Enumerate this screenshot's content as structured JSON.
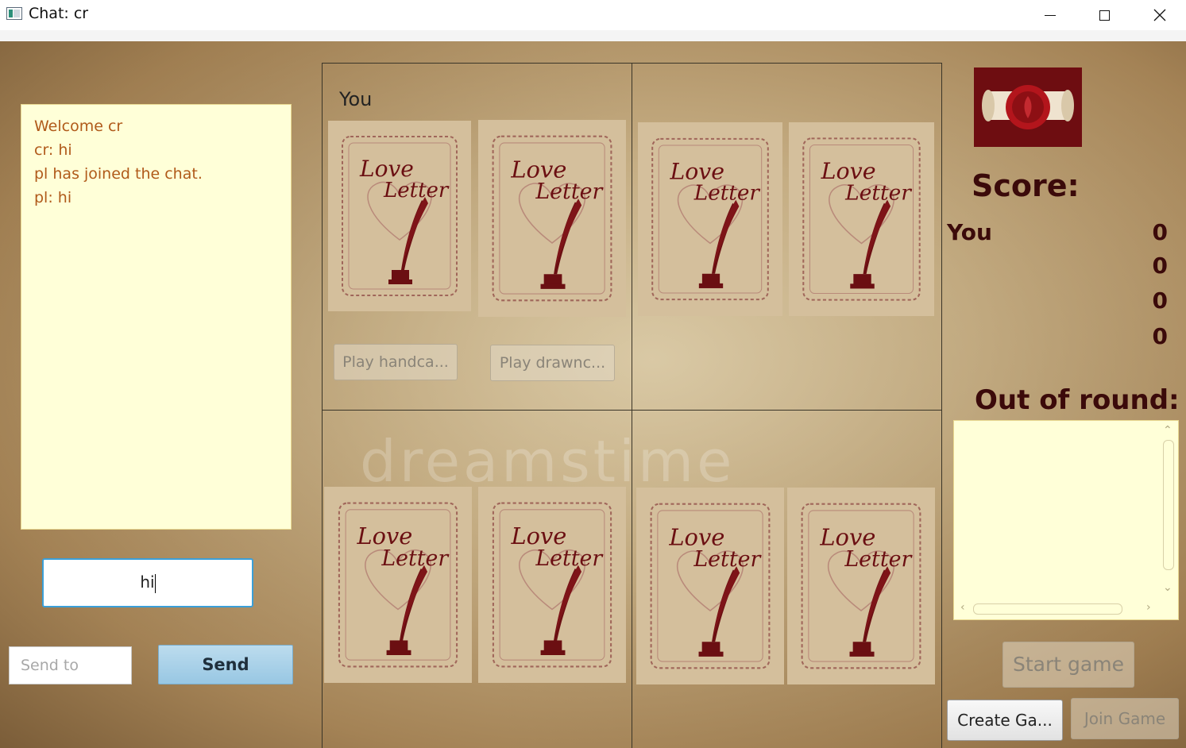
{
  "window": {
    "title": "Chat: cr"
  },
  "chat": {
    "messages": [
      "Welcome cr",
      "cr: hi",
      "pl has joined the chat.",
      "pl: hi"
    ],
    "input_value": "hi",
    "send_to_placeholder": "Send to",
    "send_label": "Send"
  },
  "board": {
    "player_label": "You",
    "play_handcard_label": "Play handca...",
    "play_drawncard_label": "Play drawnc...",
    "watermark": "dreamstime",
    "card_title": "Love Letter"
  },
  "score": {
    "title": "Score:",
    "rows": [
      {
        "name": "You",
        "value": "0"
      },
      {
        "name": "",
        "value": "0"
      },
      {
        "name": "",
        "value": "0"
      },
      {
        "name": "",
        "value": "0"
      }
    ]
  },
  "out_of_round": {
    "title": "Out of round:"
  },
  "buttons": {
    "start_game": "Start game",
    "create_game": "Create Ga...",
    "join_game": "Join Game"
  },
  "icons": {
    "app": "app-window-icon",
    "seal": "wax-seal-scroll-icon",
    "card_back": "quill-card-back-icon"
  },
  "colors": {
    "chat_text": "#b05a1a",
    "panel_bg": "#ffffd8",
    "score_text": "#3b0a0a",
    "send_button": "#a8d0e8",
    "card_art": "#6b0f12"
  }
}
